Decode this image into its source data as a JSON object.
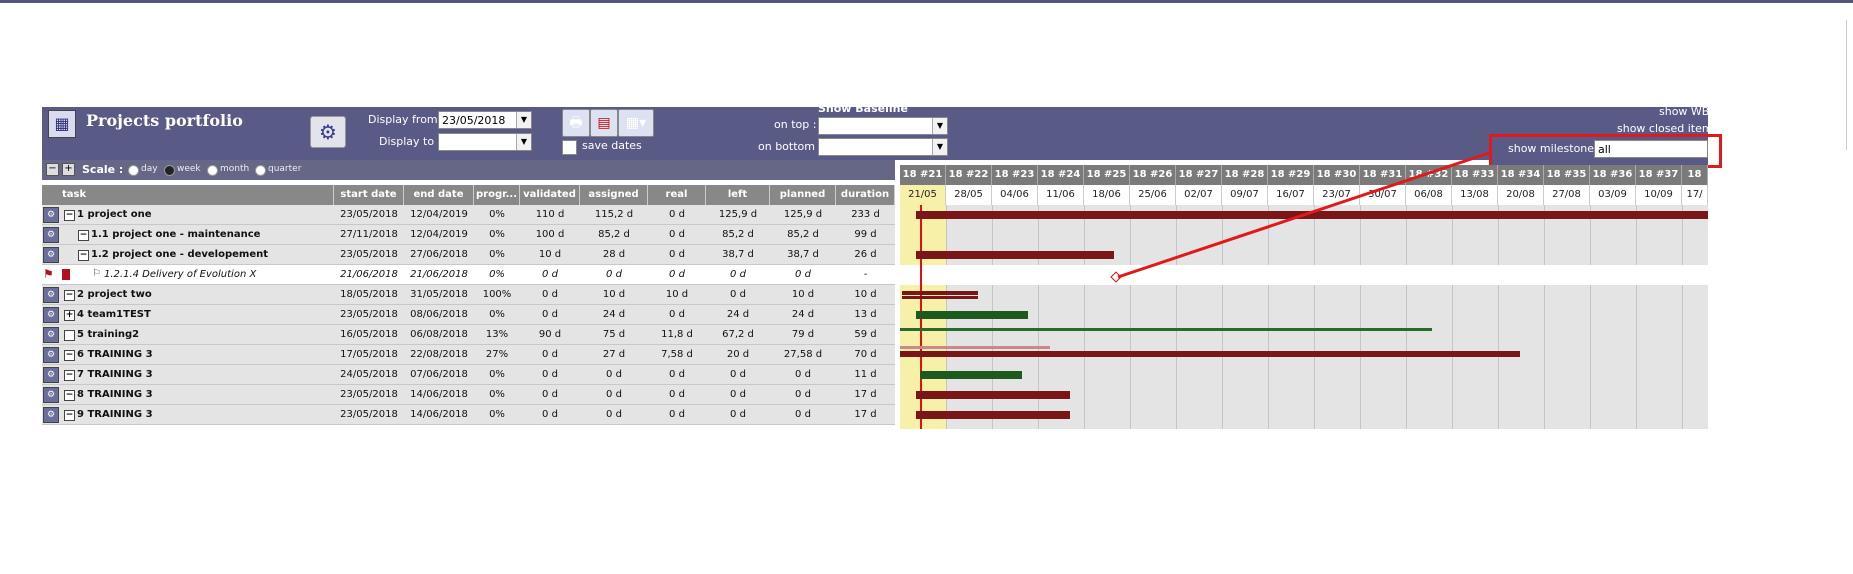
{
  "top_text": "",
  "header": {
    "title": "Projects portfolio",
    "display_from_label": "Display from",
    "display_from_value": "23/05/2018",
    "display_to_label": "Display to",
    "display_to_value": "",
    "save_dates_label": "save dates",
    "show_baseline_label": "Show Baseline",
    "on_top_label": "on top :",
    "on_bottom_label": "on bottom :",
    "show_wbs_label": "show WBS",
    "show_closed_label": "show closed items",
    "show_milestones_label": "show milestones",
    "show_milestones_value": "all"
  },
  "scale": {
    "label": "Scale :",
    "options": [
      "day",
      "week",
      "month",
      "quarter"
    ],
    "selected": "week"
  },
  "columns": [
    "task",
    "start date",
    "end date",
    "progr...",
    "validated",
    "assigned",
    "real",
    "left",
    "planned",
    "duration"
  ],
  "rows": [
    {
      "name": "1 project one",
      "start": "23/05/2018",
      "end": "12/04/2019",
      "progress": "0%",
      "validated": "110 d",
      "assigned": "115,2 d",
      "real": "0 d",
      "left": "125,9 d",
      "planned": "125,9 d",
      "duration": "233 d"
    },
    {
      "name": "1.1 project one - maintenance",
      "start": "27/11/2018",
      "end": "12/04/2019",
      "progress": "0%",
      "validated": "100 d",
      "assigned": "85,2 d",
      "real": "0 d",
      "left": "85,2 d",
      "planned": "85,2 d",
      "duration": "99 d"
    },
    {
      "name": "1.2 project one - developement",
      "start": "23/05/2018",
      "end": "27/06/2018",
      "progress": "0%",
      "validated": "10 d",
      "assigned": "28 d",
      "real": "0 d",
      "left": "38,7 d",
      "planned": "38,7 d",
      "duration": "26 d"
    },
    {
      "name": "1.2.1.4 Delivery of Evolution X",
      "start": "21/06/2018",
      "end": "21/06/2018",
      "progress": "0%",
      "validated": "0 d",
      "assigned": "0 d",
      "real": "0 d",
      "left": "0 d",
      "planned": "0 d",
      "duration": "-"
    },
    {
      "name": "2 project two",
      "start": "18/05/2018",
      "end": "31/05/2018",
      "progress": "100%",
      "validated": "0 d",
      "assigned": "10 d",
      "real": "10 d",
      "left": "0 d",
      "planned": "10 d",
      "duration": "10 d"
    },
    {
      "name": "4 team1TEST",
      "start": "23/05/2018",
      "end": "08/06/2018",
      "progress": "0%",
      "validated": "0 d",
      "assigned": "24 d",
      "real": "0 d",
      "left": "24 d",
      "planned": "24 d",
      "duration": "13 d"
    },
    {
      "name": "5 training2",
      "start": "16/05/2018",
      "end": "06/08/2018",
      "progress": "13%",
      "validated": "90 d",
      "assigned": "75 d",
      "real": "11,8 d",
      "left": "67,2 d",
      "planned": "79 d",
      "duration": "59 d"
    },
    {
      "name": "6 TRAINING 3",
      "start": "17/05/2018",
      "end": "22/08/2018",
      "progress": "27%",
      "validated": "0 d",
      "assigned": "27 d",
      "real": "7,58 d",
      "left": "20 d",
      "planned": "27,58 d",
      "duration": "70 d"
    },
    {
      "name": "7 TRAINING 3",
      "start": "24/05/2018",
      "end": "07/06/2018",
      "progress": "0%",
      "validated": "0 d",
      "assigned": "0 d",
      "real": "0 d",
      "left": "0 d",
      "planned": "0 d",
      "duration": "11 d"
    },
    {
      "name": "8 TRAINING 3",
      "start": "23/05/2018",
      "end": "14/06/2018",
      "progress": "0%",
      "validated": "0 d",
      "assigned": "0 d",
      "real": "0 d",
      "left": "0 d",
      "planned": "0 d",
      "duration": "17 d"
    },
    {
      "name": "9 TRAINING 3",
      "start": "23/05/2018",
      "end": "14/06/2018",
      "progress": "0%",
      "validated": "0 d",
      "assigned": "0 d",
      "real": "0 d",
      "left": "0 d",
      "planned": "0 d",
      "duration": "17 d"
    }
  ],
  "gantt": {
    "weeks": [
      "18 #21",
      "18 #22",
      "18 #23",
      "18 #24",
      "18 #25",
      "18 #26",
      "18 #27",
      "18 #28",
      "18 #29",
      "18 #30",
      "18 #31",
      "18 #32",
      "18 #33",
      "18 #34",
      "18 #35",
      "18 #36",
      "18 #37",
      "18"
    ],
    "dates": [
      "21/05",
      "28/05",
      "04/06",
      "11/06",
      "18/06",
      "25/06",
      "02/07",
      "09/07",
      "16/07",
      "23/07",
      "30/07",
      "06/08",
      "13/08",
      "20/08",
      "27/08",
      "03/09",
      "10/09",
      "17/"
    ]
  },
  "colors": {
    "header_bg": "#5a5a86",
    "bar_red": "#7a1518",
    "bar_green": "#1e5a1e",
    "highlight": "#e01a1a"
  }
}
